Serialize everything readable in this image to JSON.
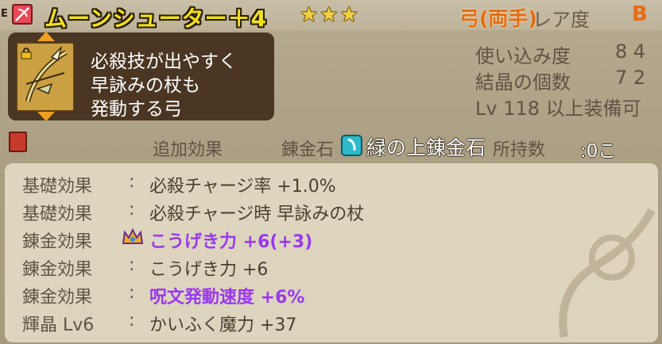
{
  "item": {
    "slot_marker": "E",
    "name": "ムーンシューター＋4",
    "stars": "★★★",
    "weapon_type": "弓(両手)",
    "rarity_label": "レア度",
    "rarity": "B"
  },
  "description": [
    "必殺技が出やすく",
    "早詠みの杖も",
    "発動する弓"
  ],
  "stats": {
    "usage_label": "使い込み度",
    "usage_value": "8 4",
    "crystals_label": "結晶の個数",
    "crystals_value": "7 2",
    "level_req": "Lv 118 以上装備可"
  },
  "alchemy": {
    "added_effects_label": "追加効果",
    "stone_label": "錬金石",
    "stone_name": "緑の上錬金石",
    "owned_label": "所持数",
    "owned_value": ":0こ"
  },
  "effects": [
    {
      "label": "基礎効果",
      "value": "必殺チャージ率 +1.0%",
      "highlight": false
    },
    {
      "label": "基礎効果",
      "value": "必殺チャージ時 早詠みの杖",
      "highlight": false
    },
    {
      "label": "錬金効果",
      "value": "こうげき力 +6(+3)",
      "highlight": true
    },
    {
      "label": "錬金効果",
      "value": "こうげき力 +6",
      "highlight": false
    },
    {
      "label": "錬金効果",
      "value": "呪文発動速度 +6%",
      "highlight": true
    },
    {
      "label": "輝晶 Lv6",
      "value": "かいふく魔力 +37",
      "highlight": false
    }
  ],
  "colors": {
    "name": "#f0e020",
    "highlight": "#9a38f0",
    "rarity": "#e86a10"
  }
}
